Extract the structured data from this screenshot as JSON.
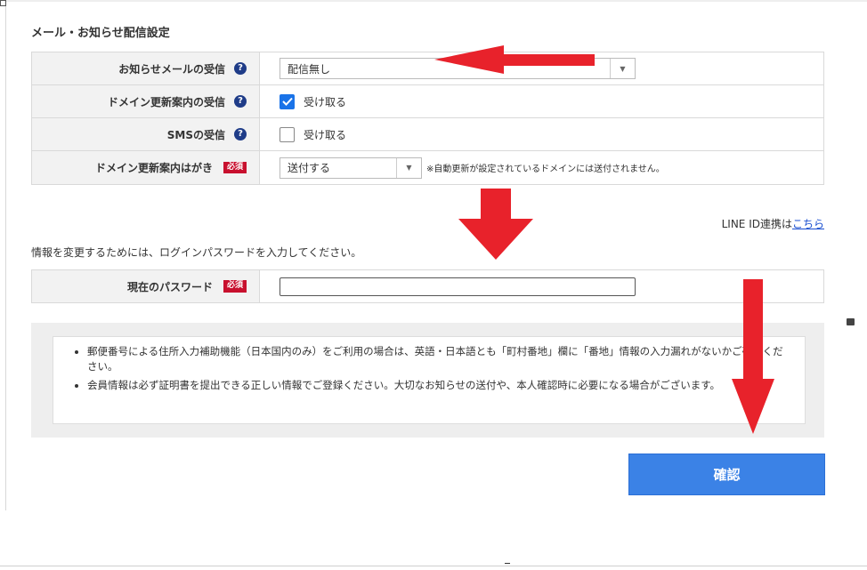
{
  "section": {
    "title": "メール・お知らせ配信設定"
  },
  "settings": {
    "notice_mail": {
      "label": "お知らせメールの受信",
      "help_icon": "question-circle-icon",
      "selected": "配信無し"
    },
    "domain_renewal_mail": {
      "label": "ドメイン更新案内の受信",
      "help_icon": "question-circle-icon",
      "checkbox_label": "受け取る",
      "checked": true
    },
    "sms": {
      "label": "SMSの受信",
      "help_icon": "question-circle-icon",
      "checkbox_label": "受け取る",
      "checked": false
    },
    "domain_renewal_postcard": {
      "label": "ドメイン更新案内はがき",
      "required_badge": "必須",
      "selected": "送付する",
      "note": "※自動更新が設定されているドメインには送付されません。"
    }
  },
  "line_link": {
    "prefix": "LINE ID連携は",
    "link_text": "こちら"
  },
  "password": {
    "instruction": "情報を変更するためには、ログインパスワードを入力してください。",
    "label": "現在のパスワード",
    "required_badge": "必須",
    "value": ""
  },
  "notices": [
    "郵便番号による住所入力補助機能（日本国内のみ）をご利用の場合は、英語・日本語とも「町村番地」欄に「番地」情報の入力漏れがないかご確認ください。",
    "会員情報は必ず証明書を提出できる正しい情報でご登録ください。大切なお知らせの送付や、本人確認時に必要になる場合がございます。"
  ],
  "confirm_button": {
    "label": "確認",
    "color": "#3b82e6"
  },
  "annotation_color": "#e8222b"
}
